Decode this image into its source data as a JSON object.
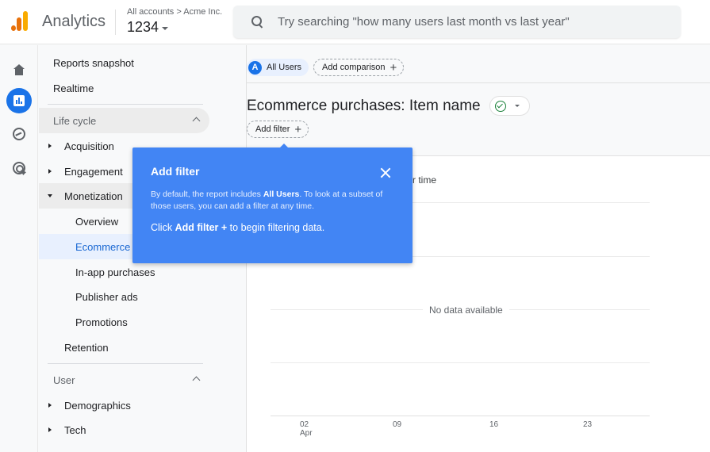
{
  "app": {
    "name": "Analytics",
    "account_path": "All accounts > Acme Inc.",
    "property": "1234"
  },
  "search": {
    "placeholder": "Try searching \"how many users last month vs last year\"",
    "value": ""
  },
  "rail": {
    "items": [
      {
        "name": "home",
        "icon": "home-icon",
        "active": false
      },
      {
        "name": "reports",
        "icon": "bar-chart-icon",
        "active": true
      },
      {
        "name": "explore",
        "icon": "explore-icon",
        "active": false
      },
      {
        "name": "advertising",
        "icon": "target-cursor-icon",
        "active": false
      }
    ]
  },
  "nav": {
    "reports_snapshot": "Reports snapshot",
    "realtime": "Realtime",
    "lifecycle": {
      "label": "Life cycle",
      "acquisition": "Acquisition",
      "engagement": "Engagement",
      "monetization": "Monetization",
      "monetization_children": {
        "overview": "Overview",
        "ecommerce": "Ecommerce purchases",
        "inapp": "In-app purchases",
        "publisher_ads": "Publisher ads",
        "promotions": "Promotions"
      },
      "retention": "Retention"
    },
    "user": {
      "label": "User",
      "demographics": "Demographics",
      "tech": "Tech"
    }
  },
  "main": {
    "segment_chip": {
      "avatar": "A",
      "label": "All Users"
    },
    "add_comparison": "Add comparison",
    "page_title": "Ecommerce purchases: Item name",
    "status": "verified",
    "add_filter": "Add filter"
  },
  "chart": {
    "title_visible_fragment": "r time",
    "no_data": "No data available",
    "x_ticks": [
      {
        "day": "02",
        "month": "Apr"
      },
      {
        "day": "09",
        "month": ""
      },
      {
        "day": "16",
        "month": ""
      },
      {
        "day": "23",
        "month": ""
      }
    ]
  },
  "popover": {
    "title": "Add filter",
    "body_prefix": "By default, the report includes ",
    "body_bold": "All Users",
    "body_suffix": ". To look at a subset of those users, you can add a filter at any time.",
    "cta_prefix": "Click ",
    "cta_bold": "Add filter +",
    "cta_suffix": " to begin filtering data."
  },
  "colors": {
    "accent": "#1a73e8",
    "popover_bg": "#4285f4",
    "selected_bg": "#e8f0fe",
    "selected_text": "#1967d2",
    "status_green": "#188038",
    "logo_orange": "#e8710a",
    "logo_yellow": "#f9ab00"
  }
}
